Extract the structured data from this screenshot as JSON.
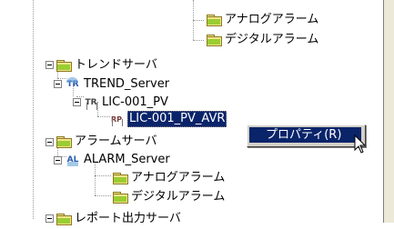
{
  "tree": {
    "items": [
      {
        "label": "アナログアラーム",
        "icon": "folder-icon"
      },
      {
        "label": "デジタルアラーム",
        "icon": "folder-icon"
      },
      {
        "label": "トレンドサーバ",
        "icon": "folder-icon"
      },
      {
        "label": "TREND_Server",
        "icon": "trend-server-icon",
        "badge": "TR"
      },
      {
        "label": "LIC-001_PV",
        "icon": "trend-tag-icon",
        "badge": "TR"
      },
      {
        "label": "LIC-001_PV_AVR",
        "icon": "report-point-icon",
        "badge": "RP",
        "selected": true
      },
      {
        "label": "アラームサーバ",
        "icon": "folder-icon"
      },
      {
        "label": "ALARM_Server",
        "icon": "alarm-server-icon",
        "badge": "AL"
      },
      {
        "label": "アナログアラーム",
        "icon": "folder-icon"
      },
      {
        "label": "デジタルアラーム",
        "icon": "folder-icon"
      },
      {
        "label": "レポート出力サーバ",
        "icon": "folder-icon"
      }
    ]
  },
  "context_menu": {
    "items": [
      {
        "label": "プロパティ(R)",
        "highlighted": true
      }
    ]
  },
  "colors": {
    "selection": "#0a246a",
    "menu_background": "#d4d0c8",
    "folder": "#f4e38a",
    "folder_accent": "#9acd32"
  }
}
